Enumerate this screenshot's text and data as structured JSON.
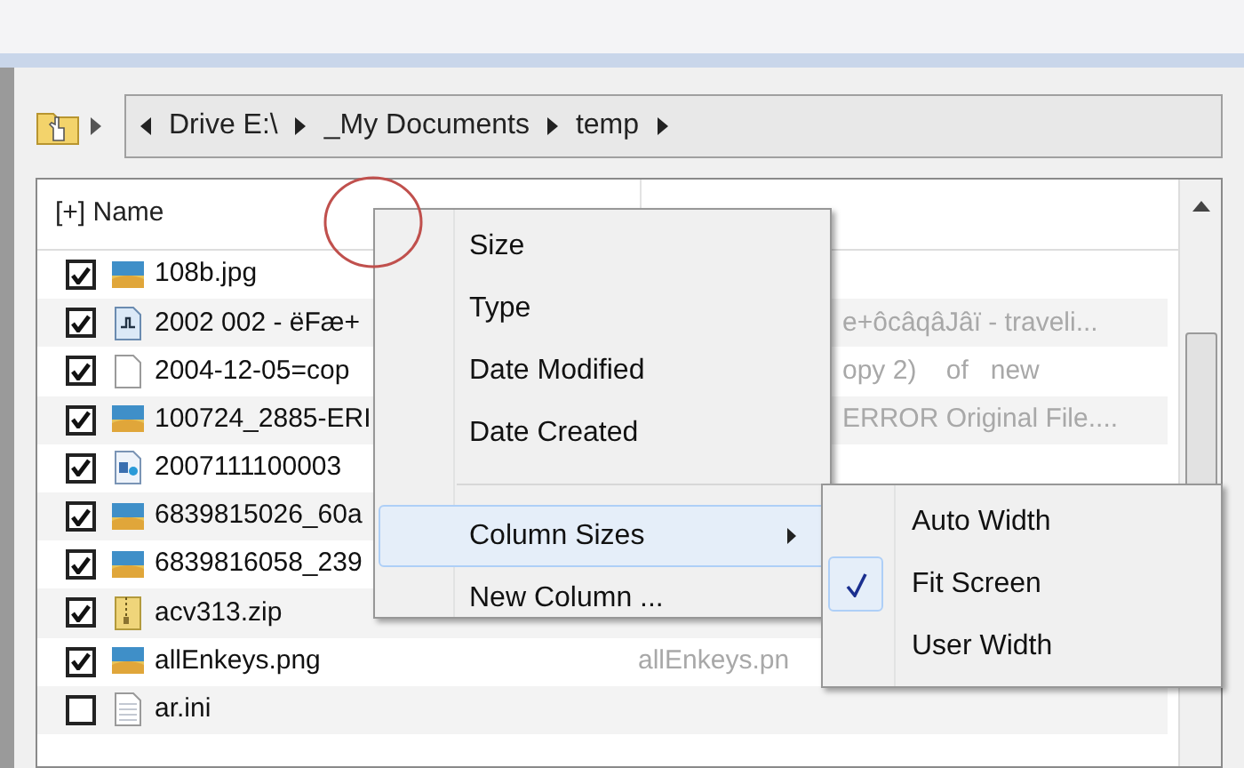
{
  "breadcrumb": [
    "Drive E:\\",
    "_My Documents",
    "temp"
  ],
  "list": {
    "header": "[+] Name",
    "rows": [
      {
        "name": "108b.jpg",
        "kind": "image",
        "checked": true,
        "detail": ""
      },
      {
        "name": "2002 002 - ëFæ+",
        "kind": "audio",
        "checked": true,
        "detail": "e+ôcâqâJâï - traveli..."
      },
      {
        "name": "2004-12-05=cop",
        "kind": "file",
        "checked": true,
        "detail": "opy 2)    of   new"
      },
      {
        "name": "100724_2885-ERI",
        "kind": "image",
        "checked": true,
        "detail": "ERROR Original File...."
      },
      {
        "name": "2007111100003",
        "kind": "video",
        "checked": true,
        "detail": ""
      },
      {
        "name": "6839815026_60a",
        "kind": "image",
        "checked": true,
        "detail": ""
      },
      {
        "name": "6839816058_239",
        "kind": "image",
        "checked": true,
        "detail": ""
      },
      {
        "name": "acv313.zip",
        "kind": "zip",
        "checked": true,
        "detail": ""
      },
      {
        "name": "allEnkeys.png",
        "kind": "image",
        "checked": true,
        "detail": "allEnkeys.pn"
      },
      {
        "name": "ar.ini",
        "kind": "text",
        "checked": false,
        "detail": ""
      }
    ]
  },
  "context_menu": {
    "items": [
      {
        "label": "Size",
        "kind": "item",
        "selected": false
      },
      {
        "label": "Type",
        "kind": "item",
        "selected": false
      },
      {
        "label": "Date Modified",
        "kind": "item",
        "selected": false
      },
      {
        "label": "Date Created",
        "kind": "item",
        "selected": false
      },
      {
        "kind": "separator"
      },
      {
        "label": "Column Sizes",
        "kind": "submenu",
        "selected": true
      },
      {
        "label": "New Column ...",
        "kind": "item",
        "selected": false
      }
    ]
  },
  "submenu": {
    "items": [
      {
        "label": "Auto Width",
        "checked": false
      },
      {
        "label": "Fit Screen",
        "checked": true
      },
      {
        "label": "User Width",
        "checked": false
      }
    ]
  }
}
